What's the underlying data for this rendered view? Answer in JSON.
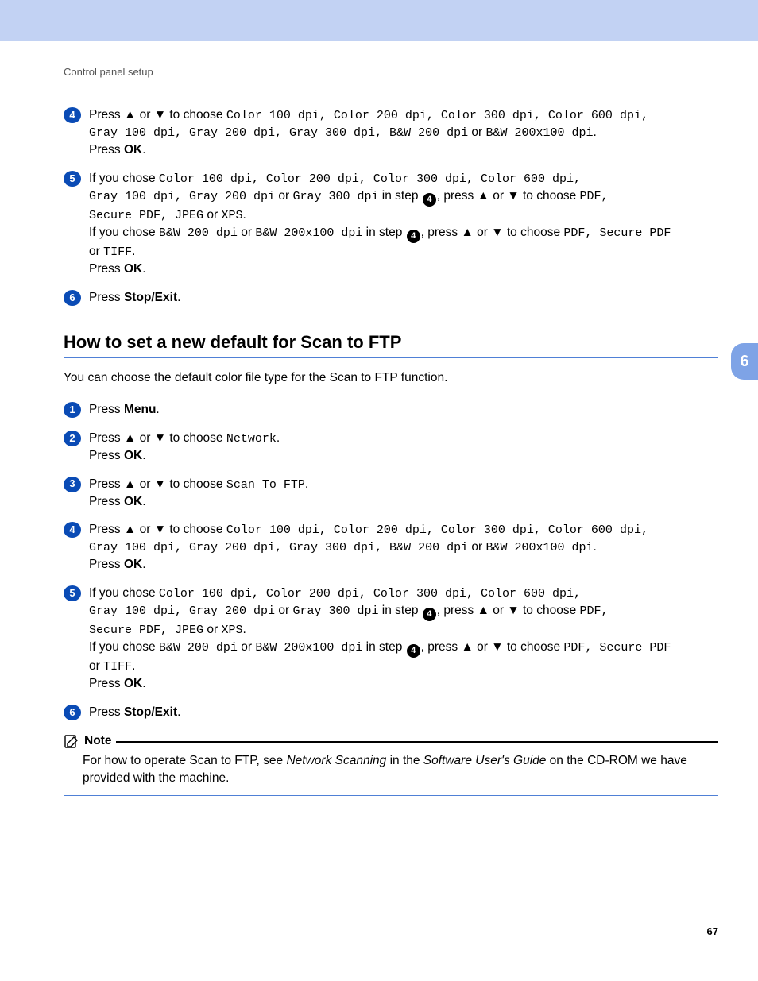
{
  "breadcrumb": "Control panel setup",
  "side_tab": "6",
  "page_number": "67",
  "arrows": {
    "up": "▲",
    "down": "▼"
  },
  "ref_step": "4",
  "top_steps": {
    "s4": {
      "n": "4",
      "l1a": "Press ",
      "l1b": " or ",
      "l1c": " to choose ",
      "opts_line1": "Color 100 dpi, Color 200 dpi, Color 300 dpi, Color 600 dpi,",
      "opts_line2_mono1": "Gray 100 dpi, Gray 200 dpi, Gray 300 dpi, B&W 200 dpi",
      "or1": " or ",
      "opts_line2_mono2": "B&W 200x100 dpi",
      "period": ".",
      "press": "Press ",
      "ok": "OK",
      "dot": "."
    },
    "s5": {
      "n": "5",
      "a1": "If you chose ",
      "a_mono1": "Color 100 dpi, Color 200 dpi, Color 300 dpi, Color 600 dpi,",
      "a_mono2a": "Gray 100 dpi, Gray 200 dpi",
      "a_or1": " or ",
      "a_mono2b": "Gray 300 dpi",
      "a_instep": " in step ",
      "a_press": ", press ",
      "a_or2": " or ",
      "a_choose": " to choose ",
      "a_mono3": "PDF,",
      "a_mono4a": "Secure PDF, JPEG",
      "a_or3": " or ",
      "a_mono4b": "XPS",
      "a_dot": ".",
      "b1": "If you chose ",
      "b_mono1a": "B&W 200 dpi",
      "b_or1": " or ",
      "b_mono1b": "B&W 200x100 dpi",
      "b_instep": " in step ",
      "b_press": ", press ",
      "b_or2": " or ",
      "b_choose": " to choose ",
      "b_mono2": "PDF, Secure PDF",
      "b_or3": " or ",
      "b_mono3": "TIFF",
      "b_dot": ".",
      "press": "Press ",
      "ok": "OK",
      "dot": "."
    },
    "s6": {
      "n": "6",
      "press": "Press ",
      "stop": "Stop/Exit",
      "dot": "."
    }
  },
  "section": {
    "title": "How to set a new default for Scan to FTP",
    "intro": "You can choose the default color file type for the Scan to FTP function."
  },
  "ftp_steps": {
    "s1": {
      "n": "1",
      "press": "Press ",
      "menu": "Menu",
      "dot": "."
    },
    "s2": {
      "n": "2",
      "l1a": "Press ",
      "l1b": " or ",
      "l1c": " to choose ",
      "mono": "Network",
      "dot": ".",
      "press": "Press ",
      "ok": "OK",
      "dot2": "."
    },
    "s3": {
      "n": "3",
      "l1a": "Press ",
      "l1b": " or ",
      "l1c": " to choose ",
      "mono": "Scan To FTP",
      "dot": ".",
      "press": "Press ",
      "ok": "OK",
      "dot2": "."
    },
    "s4": {
      "n": "4",
      "l1a": "Press ",
      "l1b": " or ",
      "l1c": " to choose ",
      "opts_line1": "Color 100 dpi, Color 200 dpi, Color 300 dpi, Color 600 dpi,",
      "opts_line2_mono1": "Gray 100 dpi, Gray 200 dpi, Gray 300 dpi, B&W 200 dpi",
      "or1": " or ",
      "opts_line2_mono2": "B&W 200x100 dpi",
      "period": ".",
      "press": "Press ",
      "ok": "OK",
      "dot": "."
    },
    "s5": {
      "n": "5",
      "a1": "If you chose ",
      "a_mono1": "Color 100 dpi, Color 200 dpi, Color 300 dpi, Color 600 dpi,",
      "a_mono2a": "Gray 100 dpi, Gray 200 dpi",
      "a_or1": " or ",
      "a_mono2b": "Gray 300 dpi",
      "a_instep": " in step ",
      "a_press": ", press ",
      "a_or2": " or ",
      "a_choose": " to choose ",
      "a_mono3": "PDF,",
      "a_mono4a": "Secure PDF, JPEG",
      "a_or3": " or ",
      "a_mono4b": "XPS",
      "a_dot": ".",
      "b1": "If you chose ",
      "b_mono1a": "B&W 200 dpi",
      "b_or1": " or ",
      "b_mono1b": "B&W 200x100 dpi",
      "b_instep": " in step ",
      "b_press": ", press ",
      "b_or2": " or ",
      "b_choose": " to choose ",
      "b_mono2": "PDF, Secure PDF",
      "b_or3": " or ",
      "b_mono3": "TIFF",
      "b_dot": ".",
      "press": "Press ",
      "ok": "OK",
      "dot": "."
    },
    "s6": {
      "n": "6",
      "press": "Press ",
      "stop": "Stop/Exit",
      "dot": "."
    }
  },
  "note": {
    "label": "Note",
    "body_a": "For how to operate Scan to FTP, see ",
    "body_i1": "Network Scanning",
    "body_b": " in the ",
    "body_i2": "Software User's Guide",
    "body_c": " on the CD-ROM we have provided with the machine."
  }
}
